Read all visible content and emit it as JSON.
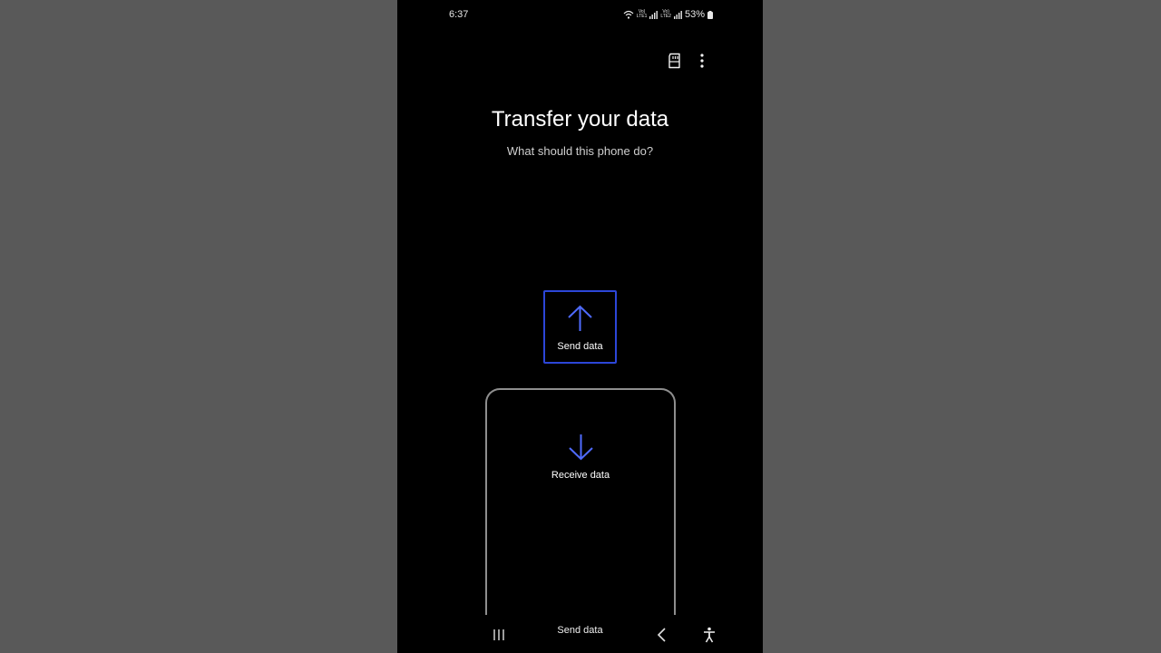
{
  "status_bar": {
    "time": "6:37",
    "network_1": "LTE1",
    "network_2": "LTE2",
    "battery": "53%"
  },
  "header": {
    "icons": [
      "sd-card-icon",
      "more-options-icon"
    ]
  },
  "main": {
    "title": "Transfer your data",
    "subtitle": "What should this phone do?",
    "send_label": "Send data",
    "receive_label": "Receive data"
  },
  "nav_bar": {
    "home_label": "Send data",
    "icons": [
      "recents-icon",
      "back-icon",
      "accessibility-icon"
    ]
  },
  "colors": {
    "accent": "#2c46d8",
    "arrow": "#4f6bff",
    "background": "#000000",
    "letterbox": "#595959"
  }
}
